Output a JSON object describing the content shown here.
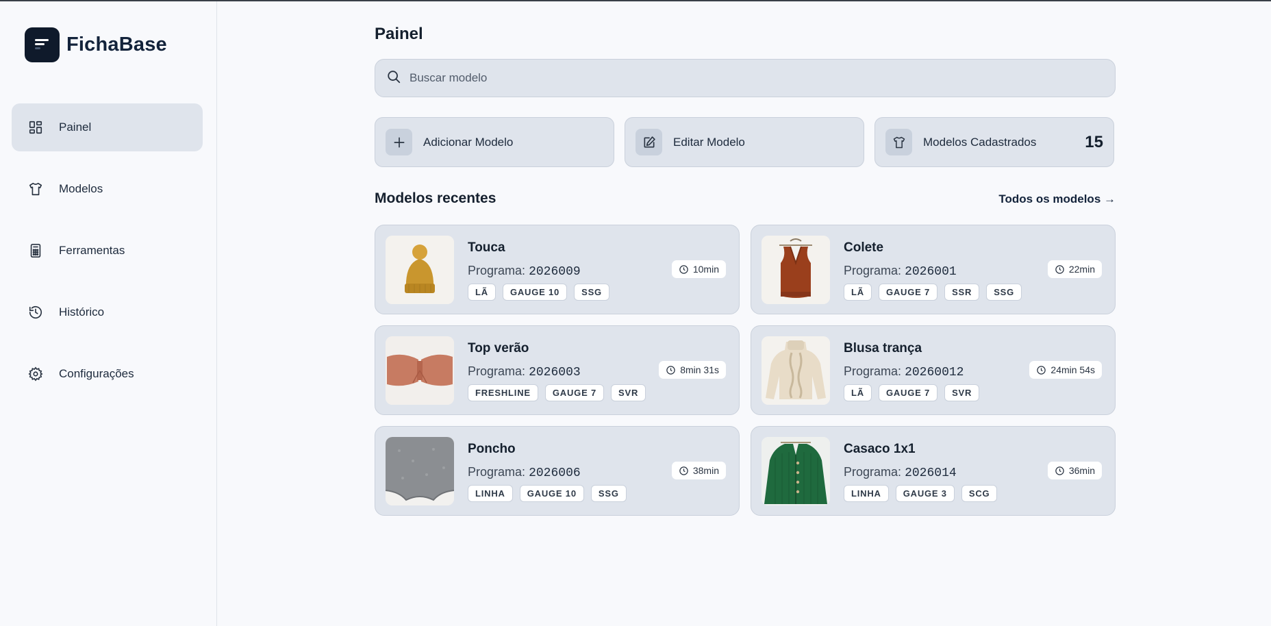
{
  "app": {
    "name": "FichaBase"
  },
  "sidebar": {
    "items": [
      {
        "label": "Painel",
        "icon": "dashboard-icon",
        "active": true
      },
      {
        "label": "Modelos",
        "icon": "shirt-icon",
        "active": false
      },
      {
        "label": "Ferramentas",
        "icon": "calculator-icon",
        "active": false
      },
      {
        "label": "Histórico",
        "icon": "history-icon",
        "active": false
      },
      {
        "label": "Configurações",
        "icon": "gear-icon",
        "active": false
      }
    ]
  },
  "main": {
    "title": "Painel",
    "search": {
      "placeholder": "Buscar modelo",
      "value": ""
    },
    "actions": {
      "add_label": "Adicionar Modelo",
      "edit_label": "Editar Modelo",
      "registered_label": "Modelos Cadastrados",
      "registered_count": "15"
    },
    "recent": {
      "title": "Modelos recentes",
      "see_all": "Todos os modelos →",
      "program_label": "Programa:",
      "cards": [
        {
          "name": "Touca",
          "program": "2026009",
          "time": "10min",
          "tags": [
            "LÃ",
            "GAUGE 10",
            "SSG"
          ],
          "thumb": "beanie-image"
        },
        {
          "name": "Colete",
          "program": "2026001",
          "time": "22min",
          "tags": [
            "LÃ",
            "GAUGE 7",
            "SSR",
            "SSG"
          ],
          "thumb": "vest-image"
        },
        {
          "name": "Top verão",
          "program": "2026003",
          "time": "8min 31s",
          "tags": [
            "FRESHLINE",
            "GAUGE 7",
            "SVR"
          ],
          "thumb": "crochet-top-image"
        },
        {
          "name": "Blusa trança",
          "program": "20260012",
          "time": "24min 54s",
          "tags": [
            "LÃ",
            "GAUGE 7",
            "SVR"
          ],
          "thumb": "cable-sweater-image"
        },
        {
          "name": "Poncho",
          "program": "2026006",
          "time": "38min",
          "tags": [
            "LINHA",
            "GAUGE 10",
            "SSG"
          ],
          "thumb": "poncho-image"
        },
        {
          "name": "Casaco 1x1",
          "program": "2026014",
          "time": "36min",
          "tags": [
            "LINHA",
            "GAUGE 3",
            "SCG"
          ],
          "thumb": "cardigan-image"
        }
      ]
    }
  }
}
